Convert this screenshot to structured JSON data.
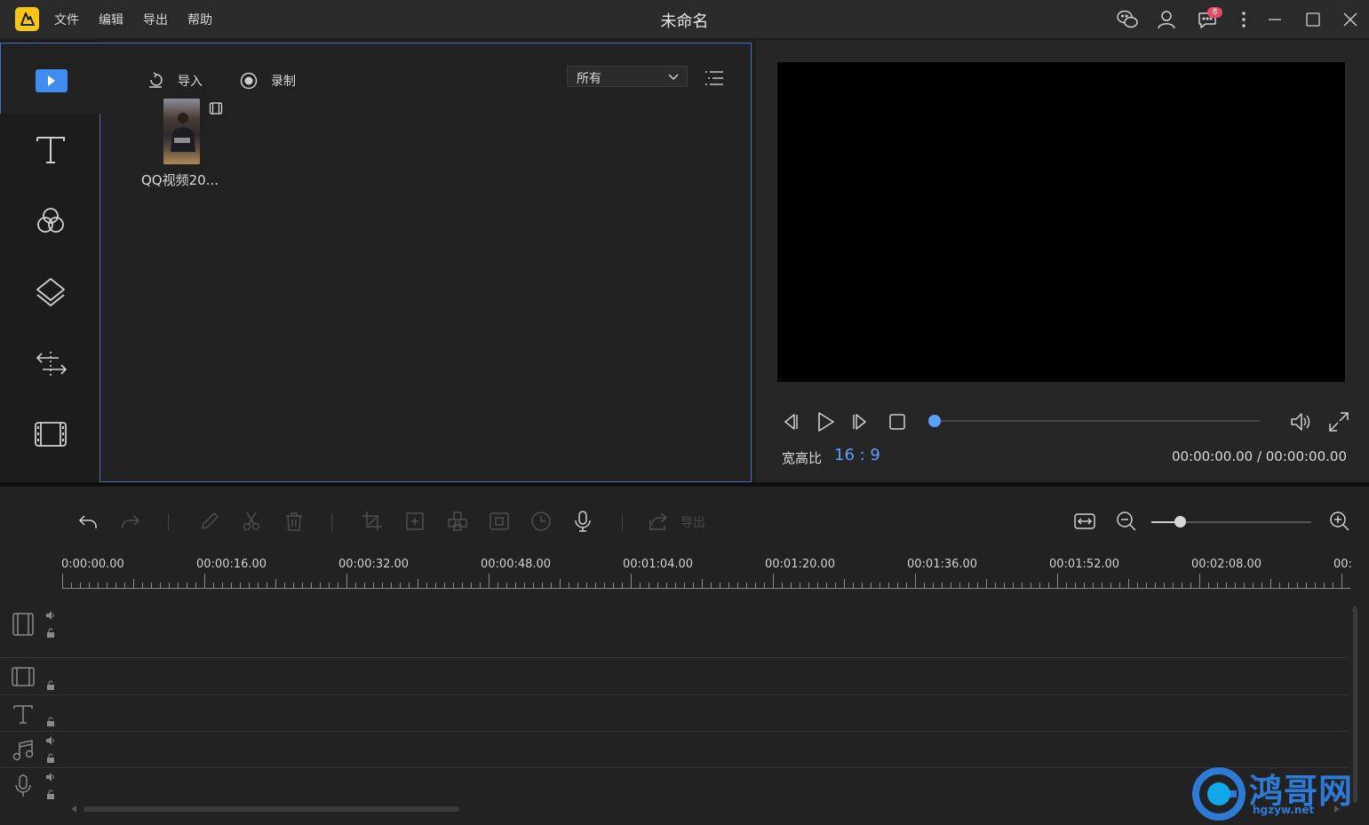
{
  "app": {
    "title": "未命名",
    "menu": [
      "文件",
      "编辑",
      "导出",
      "帮助"
    ],
    "notification_count": "8"
  },
  "titlebar_icons": [
    "wechat-icon",
    "user-icon",
    "message-icon",
    "more-icon",
    "minimize-icon",
    "maximize-icon",
    "close-icon"
  ],
  "media": {
    "import_label": "导入",
    "record_label": "录制",
    "filter_value": "所有",
    "clips": [
      {
        "name": "QQ视频20..."
      }
    ]
  },
  "rail_icons": [
    "media-icon",
    "text-icon",
    "filter-icon",
    "overlay-icon",
    "transition-icon",
    "element-icon"
  ],
  "preview": {
    "aspect_label": "宽高比",
    "aspect_value": "16 : 9",
    "timecode": "00:00:00.00 / 00:00:00.00",
    "progress": 0
  },
  "timeline": {
    "export_label": "导出",
    "zoom_level": 0.18,
    "ruler_labels": [
      "0:00:00.00",
      "00:00:16.00",
      "00:00:32.00",
      "00:00:48.00",
      "00:01:04.00",
      "00:01:20.00",
      "00:01:36.00",
      "00:01:52.00",
      "00:02:08.00",
      "00:"
    ],
    "tracks": [
      "video-main",
      "video-overlay",
      "text",
      "music",
      "voice"
    ]
  },
  "watermark": {
    "text": "鸿哥网",
    "domain": "hgzyw.net"
  },
  "colors": {
    "accent": "#5aa0ff",
    "panel_border": "#3e73c3",
    "logo": "#f5c518",
    "badge": "#e84a5f",
    "watermark": "#2d7bd6"
  }
}
